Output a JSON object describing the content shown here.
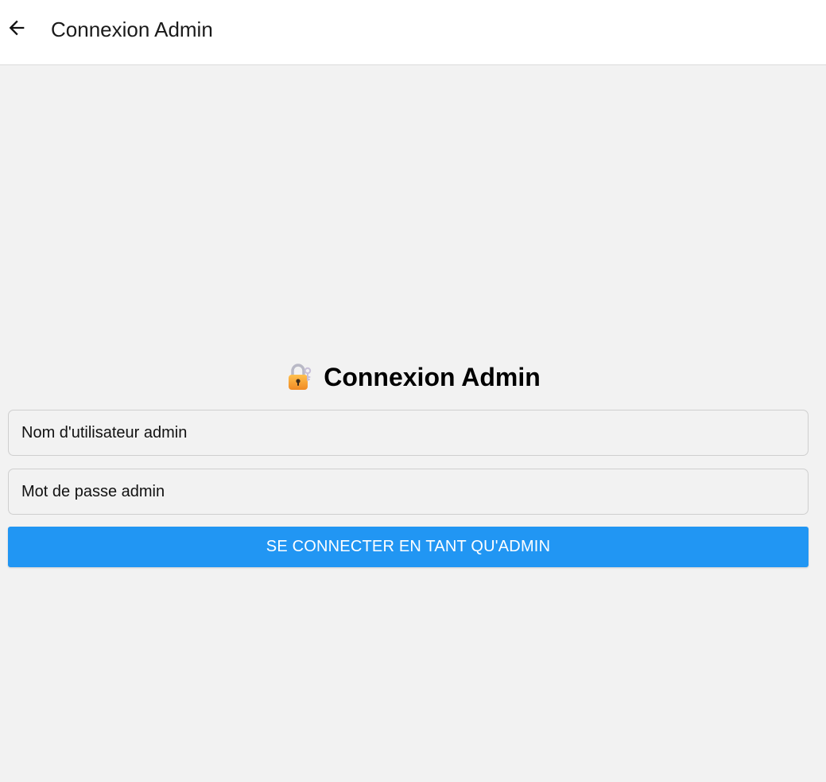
{
  "header": {
    "back_icon": "arrow-left-icon",
    "title": "Connexion Admin"
  },
  "form": {
    "heading_icon": "lock-icon",
    "heading": "Connexion Admin",
    "username": {
      "value": "",
      "placeholder": "Nom d'utilisateur admin"
    },
    "password": {
      "value": "",
      "placeholder": "Mot de passe admin"
    },
    "submit_label": "SE CONNECTER EN TANT QU'ADMIN"
  },
  "colors": {
    "background": "#f2f2f2",
    "header_background": "#ffffff",
    "primary_button": "#2196f3",
    "button_text": "#ffffff"
  }
}
